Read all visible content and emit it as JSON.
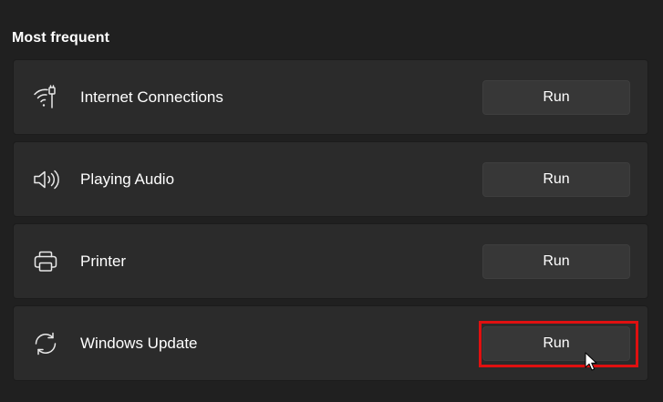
{
  "section": {
    "title": "Most frequent"
  },
  "items": [
    {
      "label": "Internet Connections",
      "icon": "wifi-icon",
      "button_label": "Run"
    },
    {
      "label": "Playing Audio",
      "icon": "speaker-icon",
      "button_label": "Run"
    },
    {
      "label": "Printer",
      "icon": "printer-icon",
      "button_label": "Run"
    },
    {
      "label": "Windows Update",
      "icon": "sync-icon",
      "button_label": "Run"
    }
  ],
  "colors": {
    "background": "#202020",
    "card": "#2b2b2b",
    "button": "#373737",
    "highlight": "#e01010"
  }
}
